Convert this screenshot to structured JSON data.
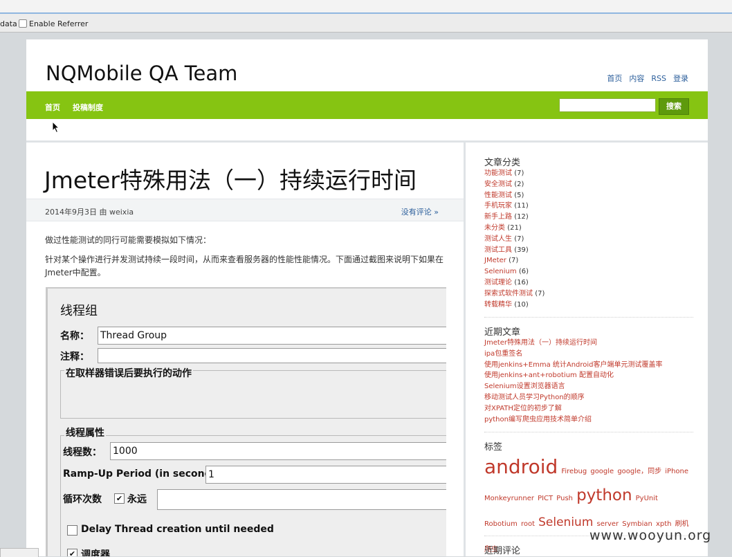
{
  "browser": {
    "toolbar_prefix": "data",
    "enable_referrer_label": "Enable Referrer"
  },
  "site": {
    "title": "NQMobile QA Team",
    "topnav": [
      "首页",
      "内容",
      "RSS",
      "登录"
    ],
    "nav": [
      "首页",
      "投稿制度"
    ],
    "search_button": "搜索",
    "search_value": ""
  },
  "post": {
    "title": "Jmeter特殊用法（一）持续运行时间",
    "date_author": "2014年9月3日 由 weixia",
    "comments": "没有评论 »",
    "para1": "做过性能测试的同行可能需要模拟如下情况：",
    "para2": "针对某个操作进行并发测试持续一段时间，从而来查看服务器的性能性能情况。下面通过截图来说明下如果在Jmeter中配置。"
  },
  "screenshot": {
    "heading": "线程组",
    "name_label": "名称：",
    "name_value": "Thread Group",
    "comment_label": "注释：",
    "error_action_label": "在取样器错误后要执行的动作",
    "thread_props_label": "线程属性",
    "thread_count_label": "线程数：",
    "thread_count_value": "1000",
    "rampup_label": "Ramp-Up Period (in seconds):",
    "rampup_value": "1",
    "loop_label": "循环次数",
    "forever_label": "永远",
    "delay_label": "Delay Thread creation until needed",
    "scheduler_label": "调度器"
  },
  "sidebar": {
    "categories_title": "文章分类",
    "categories": [
      {
        "name": "功能测试",
        "count": "(7)"
      },
      {
        "name": "安全测试",
        "count": "(2)"
      },
      {
        "name": "性能测试",
        "count": "(5)"
      },
      {
        "name": "手机玩家",
        "count": "(11)"
      },
      {
        "name": "新手上路",
        "count": "(12)"
      },
      {
        "name": "未分类",
        "count": "(21)"
      },
      {
        "name": "测试人生",
        "count": "(7)"
      },
      {
        "name": "测试工具",
        "count": "(39)"
      },
      {
        "name": "JMeter",
        "count": "(7)"
      },
      {
        "name": "Selenium",
        "count": "(6)"
      },
      {
        "name": "测试理论",
        "count": "(16)"
      },
      {
        "name": "探索式软件测试",
        "count": "(7)"
      },
      {
        "name": "转载精华",
        "count": "(10)"
      }
    ],
    "recent_title": "近期文章",
    "recent_posts": [
      "Jmeter特殊用法（一）持续运行时间",
      "ipa包重签名",
      "使用jenkins+Emma 统计Android客户端单元测试覆盖率",
      "使用jenkins+ant+robotium 配置自动化",
      "Selenium设置浏览器语言",
      "移动测试人员学习Python的顺序",
      "对XPATH定位的初步了解",
      "python编写爬虫应用技术简单介绍"
    ],
    "tags_title": "标签",
    "tags": [
      {
        "text": "android",
        "size": 28
      },
      {
        "text": "Firebug",
        "size": 10
      },
      {
        "text": "google",
        "size": 10
      },
      {
        "text": "google，同步",
        "size": 10
      },
      {
        "text": "iPhone",
        "size": 10
      },
      {
        "text": "Monkeyrunner",
        "size": 10
      },
      {
        "text": "PICT",
        "size": 10
      },
      {
        "text": "Push",
        "size": 10
      },
      {
        "text": "python",
        "size": 23
      },
      {
        "text": "PyUnit",
        "size": 10
      },
      {
        "text": "Robotium",
        "size": 10
      },
      {
        "text": "root",
        "size": 10
      },
      {
        "text": "Selenium",
        "size": 17
      },
      {
        "text": "server",
        "size": 10
      },
      {
        "text": "Symbian",
        "size": 10
      },
      {
        "text": "xpth",
        "size": 10
      },
      {
        "text": "刷机",
        "size": 10
      },
      {
        "text": "爬虫",
        "size": 10
      }
    ],
    "comments_title": "近期评论"
  },
  "watermark": "www.wooyun.org"
}
